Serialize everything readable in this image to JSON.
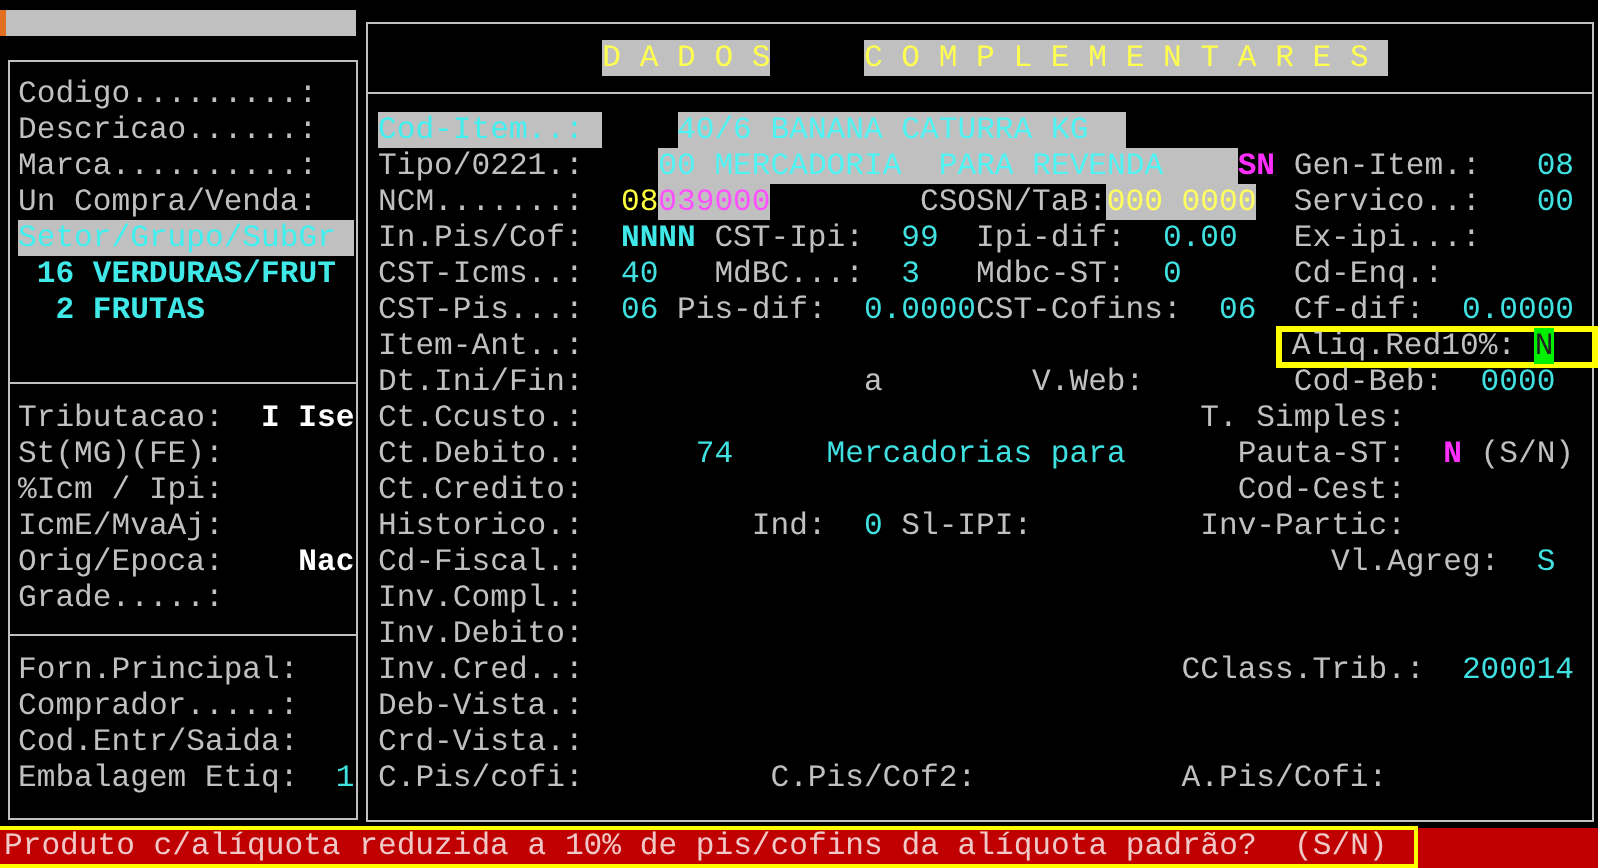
{
  "left_panel": {
    "sections": [
      {
        "rows": [
          [
            {
              "text": "Codigo.........:",
              "kind": "label"
            }
          ],
          [
            {
              "text": "Descricao......:",
              "kind": "label"
            }
          ],
          [
            {
              "text": "Marca..........:",
              "kind": "label"
            }
          ],
          [
            {
              "text": "Un Compra/Venda:",
              "kind": "label"
            }
          ],
          [
            {
              "text": "Setor/Grupo/SubGr",
              "kind": "label_hl"
            }
          ],
          [
            {
              "text": "16 VERDURAS/FRUT",
              "kind": "value_bold"
            }
          ],
          [
            {
              "text": "2 FRUTAS",
              "kind": "value_bold"
            }
          ]
        ]
      },
      {
        "rows": [
          [
            {
              "text": "Tributacao:",
              "kind": "label"
            },
            {
              "text": "I Ise",
              "kind": "value_white"
            }
          ],
          [
            {
              "text": "St(MG)(FE):",
              "kind": "label"
            }
          ],
          [
            {
              "text": "%Icm / Ipi:",
              "kind": "label"
            }
          ],
          [
            {
              "text": "IcmE/MvaAj:",
              "kind": "label"
            }
          ],
          [
            {
              "text": "Orig/Epoca:",
              "kind": "label"
            },
            {
              "text": "Nac",
              "kind": "value_white"
            }
          ],
          [
            {
              "text": "Grade.....:",
              "kind": "label"
            }
          ]
        ]
      },
      {
        "rows": [
          [
            {
              "text": "Forn.Principal:",
              "kind": "label"
            }
          ],
          [
            {
              "text": "Comprador.....:",
              "kind": "label"
            }
          ],
          [
            {
              "text": "Cod.Entr/Saida:",
              "kind": "label"
            }
          ],
          [
            {
              "text": "Embalagem Etiq:",
              "kind": "label"
            },
            {
              "text": "1",
              "kind": "value"
            }
          ]
        ]
      }
    ]
  },
  "right_panel": {
    "title": [
      {
        "text": "D A D O S",
        "kind": "title"
      },
      {
        "text": "C O M P L E M E N T A R E S",
        "kind": "title"
      }
    ],
    "rows": [
      {
        "fields": [
          {
            "text": "Cod-Item..:",
            "kind": "label_hl"
          },
          {
            "text": "40/6 BANANA CATURRA KG",
            "kind": "value_hl"
          }
        ]
      },
      {
        "fields": [
          {
            "text": "Tipo/0221.:",
            "kind": "label"
          },
          {
            "text": "00 MERCADORIA  PARA REVENDA",
            "kind": "value_hl"
          },
          {
            "text": "SN",
            "kind": "value_magenta"
          }
        ],
        "side": [
          {
            "text": "Gen-Item.:",
            "kind": "label"
          },
          {
            "text": "08",
            "kind": "value"
          }
        ]
      },
      {
        "fields": [
          {
            "text": "NCM.......:",
            "kind": "label"
          },
          {
            "text": "08",
            "kind": "value_yellow"
          },
          {
            "text": "039000",
            "kind": "value_magenta_hl"
          },
          {
            "text": "CSOSN/TaB:",
            "kind": "label"
          },
          {
            "text": "000 0000",
            "kind": "value_yellow_hl"
          }
        ],
        "side": [
          {
            "text": "Servico..:",
            "kind": "label"
          },
          {
            "text": "00",
            "kind": "value"
          }
        ]
      },
      {
        "fields": [
          {
            "text": "In.Pis/Cof:",
            "kind": "label"
          },
          {
            "text": "NNNN",
            "kind": "value_bold"
          },
          {
            "text": "CST-Ipi:",
            "kind": "label"
          },
          {
            "text": "99",
            "kind": "value"
          },
          {
            "text": "Ipi-dif:",
            "kind": "label"
          },
          {
            "text": "0.00",
            "kind": "value"
          }
        ],
        "side": [
          {
            "text": "Ex-ipi...:",
            "kind": "label"
          }
        ]
      },
      {
        "fields": [
          {
            "text": "CST-Icms..:",
            "kind": "label"
          },
          {
            "text": "40",
            "kind": "value"
          },
          {
            "text": "MdBC...:",
            "kind": "label"
          },
          {
            "text": "3",
            "kind": "value"
          },
          {
            "text": "Mdbc-ST:",
            "kind": "label"
          },
          {
            "text": "0",
            "kind": "value"
          }
        ],
        "side": [
          {
            "text": "Cd-Enq.:",
            "kind": "label"
          }
        ]
      },
      {
        "fields": [
          {
            "text": "CST-Pis...:",
            "kind": "label"
          },
          {
            "text": "06",
            "kind": "value"
          },
          {
            "text": "Pis-dif:",
            "kind": "label"
          },
          {
            "text": "0.0000",
            "kind": "value"
          },
          {
            "text": "CST-Cofins:",
            "kind": "label"
          },
          {
            "text": "06",
            "kind": "value"
          }
        ],
        "side": [
          {
            "text": "Cf-dif:",
            "kind": "label"
          },
          {
            "text": "0.0000",
            "kind": "value"
          }
        ]
      },
      {
        "fields": [
          {
            "text": "Item-Ant..:",
            "kind": "label"
          }
        ],
        "side": [
          {
            "kind": "focus",
            "label": "Aliq.Red10%:",
            "value": "N"
          }
        ]
      },
      {
        "fields": [
          {
            "text": "Dt.Ini/Fin:",
            "kind": "label"
          },
          {
            "text": "a",
            "kind": "plain"
          },
          {
            "text": "V.Web:",
            "kind": "label"
          }
        ],
        "side": [
          {
            "text": "Cod-Beb:",
            "kind": "label"
          },
          {
            "text": "0000",
            "kind": "value"
          }
        ]
      },
      {
        "fields": [
          {
            "text": "Ct.Ccusto.:",
            "kind": "label"
          },
          {
            "text": "T. Simples:",
            "kind": "label"
          }
        ]
      },
      {
        "fields": [
          {
            "text": "Ct.Debito.:",
            "kind": "label"
          },
          {
            "text": "74",
            "kind": "value"
          },
          {
            "text": "Mercadorias para",
            "kind": "value"
          },
          {
            "text": "Pauta-ST:",
            "kind": "label"
          },
          {
            "text": "N",
            "kind": "value_magenta"
          },
          {
            "text": "(S/N)",
            "kind": "plain"
          }
        ]
      },
      {
        "fields": [
          {
            "text": "Ct.Credito:",
            "kind": "label"
          },
          {
            "text": "Cod-Cest:",
            "kind": "label"
          }
        ]
      },
      {
        "fields": [
          {
            "text": "Historico.:",
            "kind": "label"
          },
          {
            "text": "Ind:",
            "kind": "label"
          },
          {
            "text": "0",
            "kind": "value"
          },
          {
            "text": "Sl-IPI:",
            "kind": "label"
          },
          {
            "text": "Inv-Partic:",
            "kind": "label"
          }
        ]
      },
      {
        "fields": [
          {
            "text": "Cd-Fiscal.:",
            "kind": "label"
          },
          {
            "text": "Vl.Agreg:",
            "kind": "label"
          },
          {
            "text": "S",
            "kind": "value"
          }
        ]
      },
      {
        "fields": [
          {
            "text": "Inv.Compl.:",
            "kind": "label"
          }
        ]
      },
      {
        "fields": [
          {
            "text": "Inv.Debito:",
            "kind": "label"
          }
        ]
      },
      {
        "fields": [
          {
            "text": "Inv.Cred..:",
            "kind": "label"
          },
          {
            "text": "CClass.Trib.:",
            "kind": "label"
          },
          {
            "text": "200014",
            "kind": "value"
          }
        ]
      },
      {
        "fields": [
          {
            "text": "Deb-Vista.:",
            "kind": "label"
          }
        ]
      },
      {
        "fields": [
          {
            "text": "Crd-Vista.:",
            "kind": "label"
          }
        ]
      },
      {
        "fields": [
          {
            "text": "C.Pis/cofi:",
            "kind": "label"
          },
          {
            "text": "C.Pis/Cof2:",
            "kind": "label"
          },
          {
            "text": "A.Pis/Cofi:",
            "kind": "label"
          }
        ]
      }
    ]
  },
  "status_bar": {
    "message": "Produto c/alíquota reduzida a 10% de pis/cofins da alíquota padrão?  (S/N)"
  }
}
